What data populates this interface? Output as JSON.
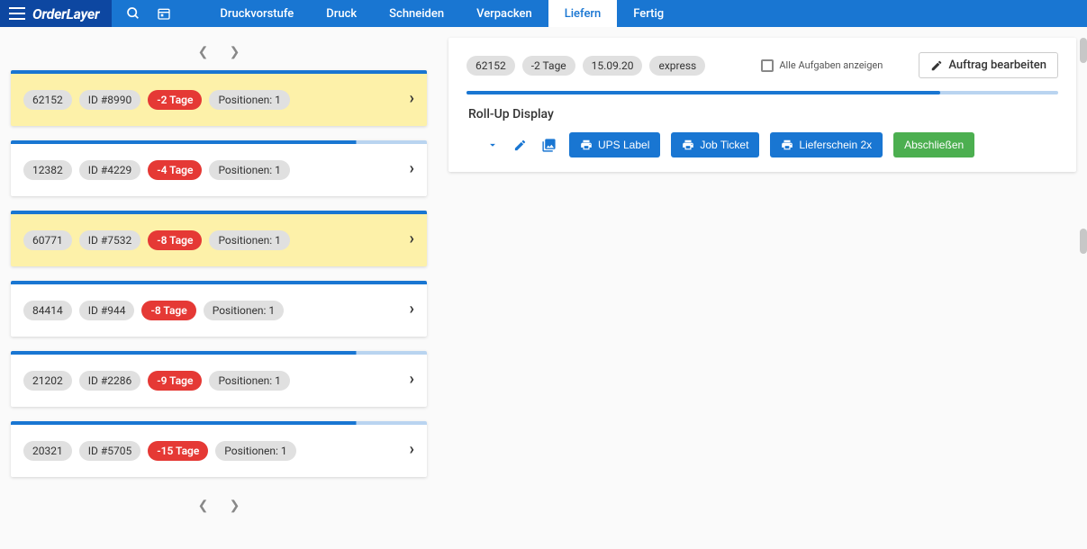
{
  "header": {
    "logo": "OrderLayer",
    "nav": [
      "Druckvorstufe",
      "Druck",
      "Schneiden",
      "Verpacken",
      "Liefern",
      "Fertig"
    ],
    "active_nav": 4
  },
  "orders": [
    {
      "num": "62152",
      "id": "ID #8990",
      "days": "-2 Tage",
      "pos": "Positionen: 1",
      "hl": true,
      "barPartial": false
    },
    {
      "num": "12382",
      "id": "ID #4229",
      "days": "-4 Tage",
      "pos": "Positionen: 1",
      "hl": false,
      "barPartial": true
    },
    {
      "num": "60771",
      "id": "ID #7532",
      "days": "-8 Tage",
      "pos": "Positionen: 1",
      "hl": true,
      "barPartial": false
    },
    {
      "num": "84414",
      "id": "ID #944",
      "days": "-8 Tage",
      "pos": "Positionen: 1",
      "hl": false,
      "barPartial": false
    },
    {
      "num": "21202",
      "id": "ID #2286",
      "days": "-9 Tage",
      "pos": "Positionen: 1",
      "hl": false,
      "barPartial": true
    },
    {
      "num": "20321",
      "id": "ID #5705",
      "days": "-15 Tage",
      "pos": "Positionen: 1",
      "hl": false,
      "barPartial": true
    }
  ],
  "detail": {
    "num": "62152",
    "days": "-2 Tage",
    "date": "15.09.20",
    "ship": "express",
    "showAll": "Alle Aufgaben anzeigen",
    "edit": "Auftrag bearbeiten",
    "itemTitle": "Roll-Up Display",
    "btn_ups": "UPS Label",
    "btn_job": "Job Ticket",
    "btn_lief": "Lieferschein 2x",
    "btn_close": "Abschließen"
  }
}
